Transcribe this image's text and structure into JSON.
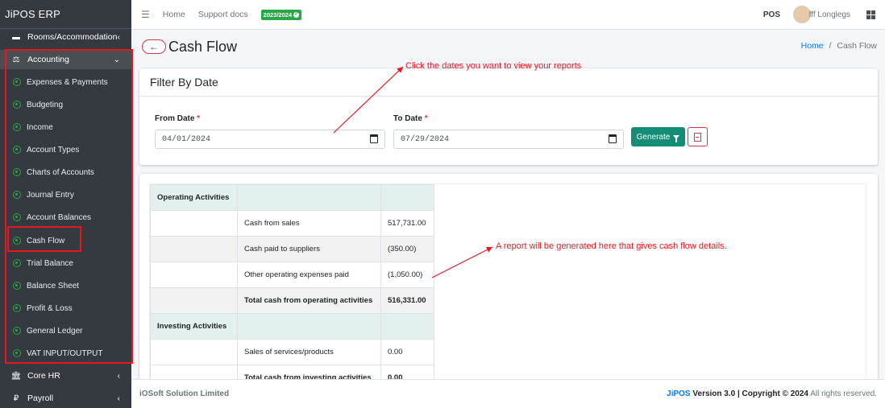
{
  "brand": "JiPOS ERP",
  "sidebar": {
    "top_item": "Rooms/Accommodation",
    "accounting": "Accounting",
    "sub_items": [
      "Expenses & Payments",
      "Budgeting",
      "Income",
      "Account Types",
      "Charts of Accounts",
      "Journal Entry",
      "Account Balances",
      "Cash Flow",
      "Trial Balance",
      "Balance Sheet",
      "Profit & Loss",
      "General Ledger",
      "VAT INPUT/OUTPUT"
    ],
    "core_hr": "Core HR",
    "payroll": "Payroll"
  },
  "topbar": {
    "home": "Home",
    "support": "Support docs",
    "year_badge": "2023/2024",
    "pos": "POS",
    "username": "fff Longlegs"
  },
  "page": {
    "title": "Cash Flow",
    "breadcrumb_home": "Home",
    "breadcrumb_sep": "/",
    "breadcrumb_current": "Cash Flow"
  },
  "filter": {
    "header": "Filter By Date",
    "from_label": "From Date",
    "to_label": "To Date",
    "required_mark": "*",
    "from_value": "04/01/2024",
    "to_value": "07/29/2024",
    "generate": "Generate"
  },
  "report": {
    "operating_header": "Operating Activities",
    "rows_operating": [
      {
        "label": "Cash from sales",
        "value": "517,731.00"
      },
      {
        "label": "Cash paid to suppliers",
        "value": "(350.00)"
      },
      {
        "label": "Other operating expenses paid",
        "value": "(1,050.00)"
      }
    ],
    "total_operating_label": "Total cash from operating activities",
    "total_operating_value": "516,331.00",
    "investing_header": "Investing Activities",
    "rows_investing": [
      {
        "label": "Sales of services/products",
        "value": "0.00"
      }
    ],
    "total_investing_label": "Total cash from investing activities",
    "total_investing_value": "0.00"
  },
  "annotations": {
    "dates_hint": "Click the dates you want to view your reports",
    "report_hint": "A report will be generated here that gives cash flow details."
  },
  "footer": {
    "company": "iOSoft Solution Limited",
    "brand": "JiPOS",
    "version": "Version 3.0 | Copyright © 2024",
    "rights": "All rights reserved."
  },
  "colors": {
    "sidebar_bg": "#343a40",
    "accent_green": "#138d75",
    "badge_green": "#28a745",
    "highlight_red": "#e8161e"
  }
}
